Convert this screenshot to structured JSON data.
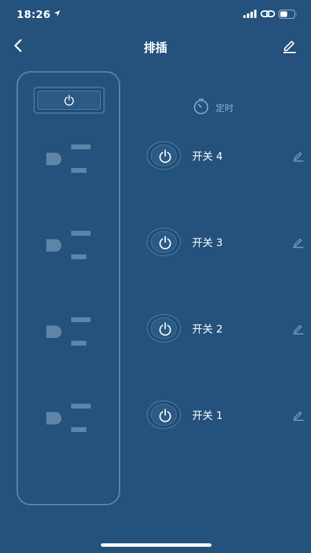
{
  "status_bar": {
    "time": "18:26",
    "icons": [
      "location-arrow-icon",
      "cellular-signal-icon",
      "link-icon",
      "battery-icon"
    ]
  },
  "nav": {
    "title": "排插",
    "back_icon": "chevron-left-icon",
    "edit_icon": "pencil-icon"
  },
  "timer": {
    "label": "定时",
    "icon": "timer-icon"
  },
  "switches": [
    {
      "label": "开关 4"
    },
    {
      "label": "开关 3"
    },
    {
      "label": "开关 2"
    },
    {
      "label": "开关 1"
    }
  ],
  "colors": {
    "background": "#24527c",
    "outline": "#5f83a3",
    "socket": "#5e84a7",
    "button_fill": "#2a5a85",
    "label_muted": "#8fb1cd",
    "text": "#ffffff"
  }
}
